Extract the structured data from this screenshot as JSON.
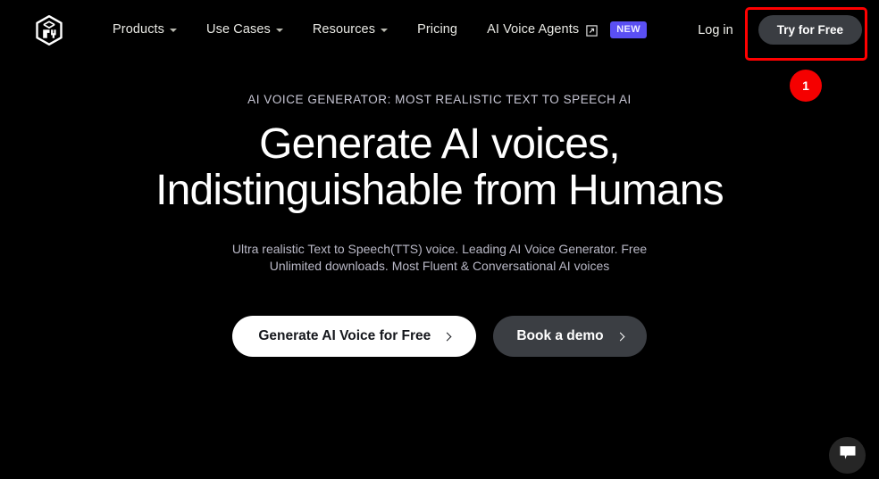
{
  "page": {
    "background": "#000000",
    "accent_new_badge": "#5a4ff3",
    "annotation_color": "#ff0000"
  },
  "navbar": {
    "logo_name": "cube-logo",
    "links": [
      {
        "label": "Products",
        "has_caret": true,
        "icon": "chevron-down-icon"
      },
      {
        "label": "Use Cases",
        "has_caret": true,
        "icon": "chevron-down-icon"
      },
      {
        "label": "Resources",
        "has_caret": true,
        "icon": "chevron-down-icon"
      },
      {
        "label": "Pricing",
        "has_caret": false,
        "icon": ""
      },
      {
        "label": "AI Voice Agents",
        "has_caret": false,
        "icon": "external-link-icon",
        "badge": "NEW"
      }
    ],
    "login_label": "Log in",
    "try_free_label": "Try for Free"
  },
  "annotation": {
    "badge_number": "1",
    "target": "try-for-free-button"
  },
  "hero": {
    "eyebrow": "AI VOICE GENERATOR: MOST REALISTIC TEXT TO SPEECH AI",
    "headline": "Generate AI voices, Indistinguishable from Humans",
    "subtitle": "Ultra realistic Text to Speech(TTS) voice. Leading AI Voice Generator. Free Unlimited downloads. Most Fluent & Conversational AI voices",
    "cta_primary": "Generate AI Voice for Free",
    "cta_secondary": "Book a demo"
  },
  "chat": {
    "icon": "chat-bubble-icon"
  }
}
